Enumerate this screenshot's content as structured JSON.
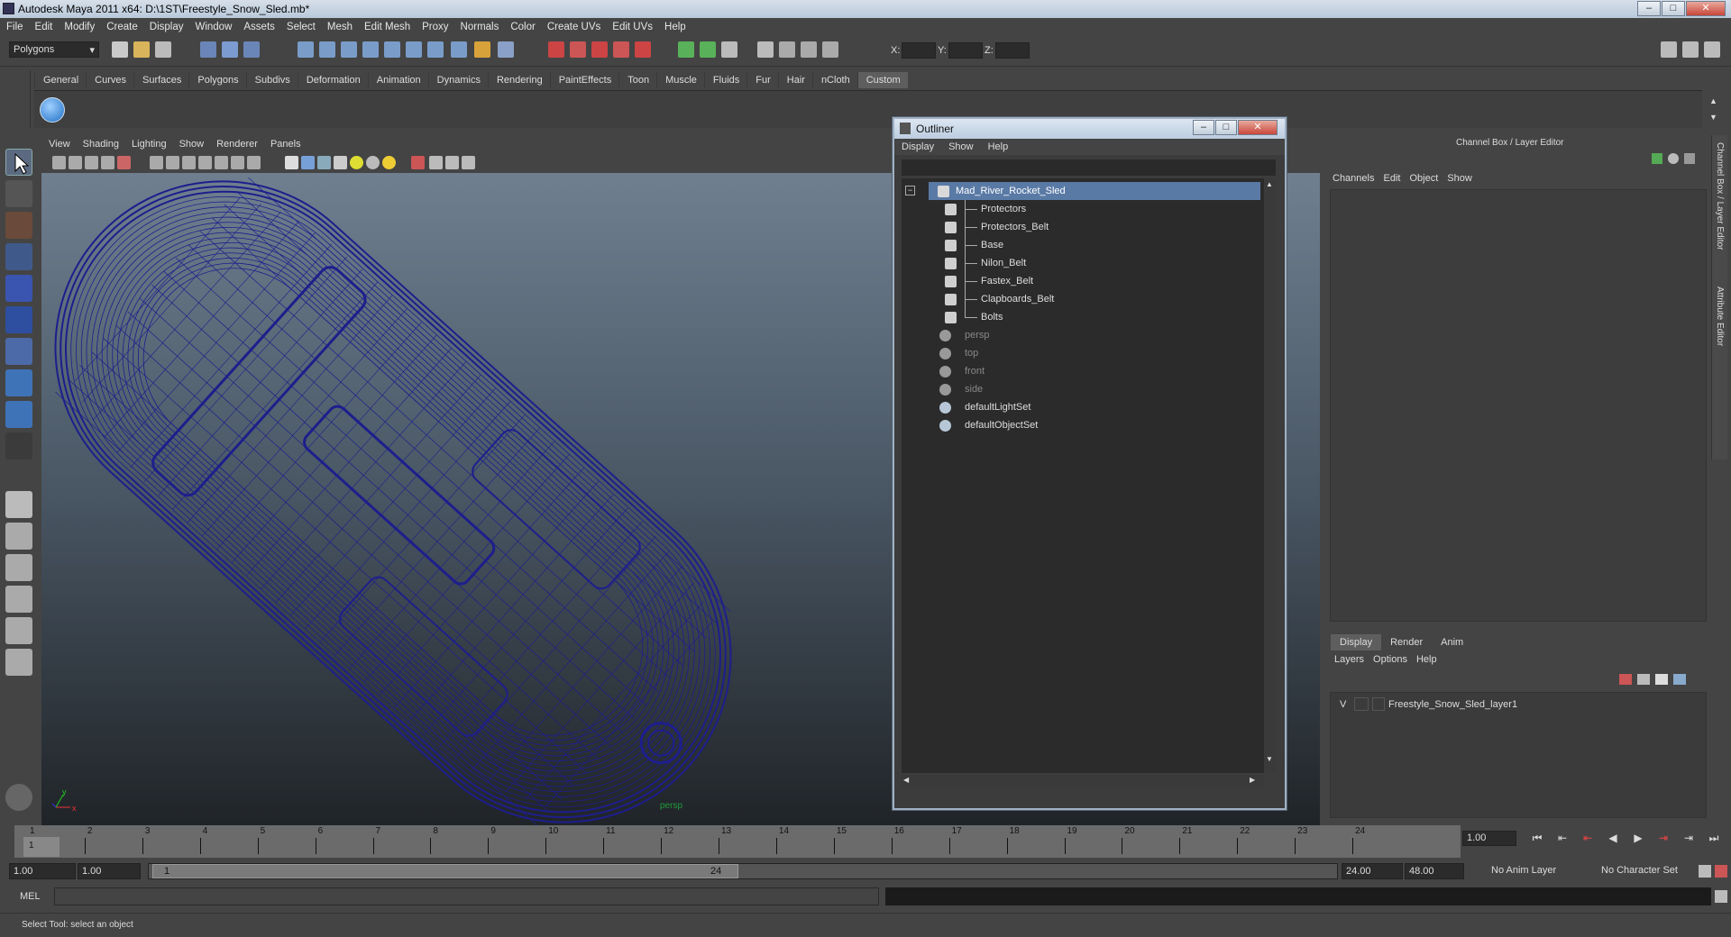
{
  "window": {
    "title": "Autodesk Maya 2011 x64: D:\\1ST\\Freestyle_Snow_Sled.mb*"
  },
  "menubar": [
    "File",
    "Edit",
    "Modify",
    "Create",
    "Display",
    "Window",
    "Assets",
    "Select",
    "Mesh",
    "Edit Mesh",
    "Proxy",
    "Normals",
    "Color",
    "Create UVs",
    "Edit UVs",
    "Help"
  ],
  "status": {
    "mode": "Polygons",
    "x_label": "X:",
    "y_label": "Y:",
    "z_label": "Z:"
  },
  "shelf_tabs": [
    "General",
    "Curves",
    "Surfaces",
    "Polygons",
    "Subdivs",
    "Deformation",
    "Animation",
    "Dynamics",
    "Rendering",
    "PaintEffects",
    "Toon",
    "Muscle",
    "Fluids",
    "Fur",
    "Hair",
    "nCloth",
    "Custom"
  ],
  "shelf_active": "Custom",
  "viewport": {
    "menus": [
      "View",
      "Shading",
      "Lighting",
      "Show",
      "Renderer",
      "Panels"
    ],
    "camera_label": "persp",
    "wire_color": "#1e1e8c"
  },
  "outliner": {
    "title": "Outliner",
    "menus": [
      "Display",
      "Show",
      "Help"
    ],
    "items": [
      {
        "name": "Mad_River_Rocket_Sled",
        "selected": true,
        "child": false,
        "dim": false,
        "icon": "transform-icon"
      },
      {
        "name": "Protectors",
        "selected": false,
        "child": true,
        "dim": false,
        "icon": "mesh-icon"
      },
      {
        "name": "Protectors_Belt",
        "selected": false,
        "child": true,
        "dim": false,
        "icon": "mesh-icon"
      },
      {
        "name": "Base",
        "selected": false,
        "child": true,
        "dim": false,
        "icon": "mesh-icon"
      },
      {
        "name": "Nilon_Belt",
        "selected": false,
        "child": true,
        "dim": false,
        "icon": "mesh-icon"
      },
      {
        "name": "Fastex_Belt",
        "selected": false,
        "child": true,
        "dim": false,
        "icon": "mesh-icon"
      },
      {
        "name": "Clapboards_Belt",
        "selected": false,
        "child": true,
        "dim": false,
        "icon": "mesh-icon"
      },
      {
        "name": "Bolts",
        "selected": false,
        "child": true,
        "dim": false,
        "icon": "mesh-icon"
      },
      {
        "name": "persp",
        "selected": false,
        "child": false,
        "dim": true,
        "icon": "camera-icon"
      },
      {
        "name": "top",
        "selected": false,
        "child": false,
        "dim": true,
        "icon": "camera-icon"
      },
      {
        "name": "front",
        "selected": false,
        "child": false,
        "dim": true,
        "icon": "camera-icon"
      },
      {
        "name": "side",
        "selected": false,
        "child": false,
        "dim": true,
        "icon": "camera-icon"
      },
      {
        "name": "defaultLightSet",
        "selected": false,
        "child": false,
        "dim": false,
        "icon": "set-icon"
      },
      {
        "name": "defaultObjectSet",
        "selected": false,
        "child": false,
        "dim": false,
        "icon": "set-icon"
      }
    ]
  },
  "channel_box": {
    "title": "Channel Box / Layer Editor",
    "menus": [
      "Channels",
      "Edit",
      "Object",
      "Show"
    ],
    "side_tabs": [
      "Channel Box / Layer Editor",
      "Attribute Editor"
    ],
    "layer_tabs": [
      "Display",
      "Render",
      "Anim"
    ],
    "layer_menus": [
      "Layers",
      "Options",
      "Help"
    ],
    "layer_row": {
      "visibility": "V",
      "name": "Freestyle_Snow_Sled_layer1"
    }
  },
  "timeline": {
    "ticks": [
      "1",
      "2",
      "3",
      "4",
      "5",
      "6",
      "7",
      "8",
      "9",
      "10",
      "11",
      "12",
      "13",
      "14",
      "15",
      "16",
      "17",
      "18",
      "19",
      "20",
      "21",
      "22",
      "23",
      "24"
    ],
    "current_frame": "1",
    "current_field": "1.00"
  },
  "range": {
    "start": "1.00",
    "inner_start": "1.00",
    "slider_start": "1",
    "slider_end": "24",
    "end": "24.00",
    "outer_end": "48.00",
    "anim_layer": "No Anim Layer",
    "character_set": "No Character Set"
  },
  "mel": {
    "label": "MEL"
  },
  "help_line": "Select Tool: select an object"
}
